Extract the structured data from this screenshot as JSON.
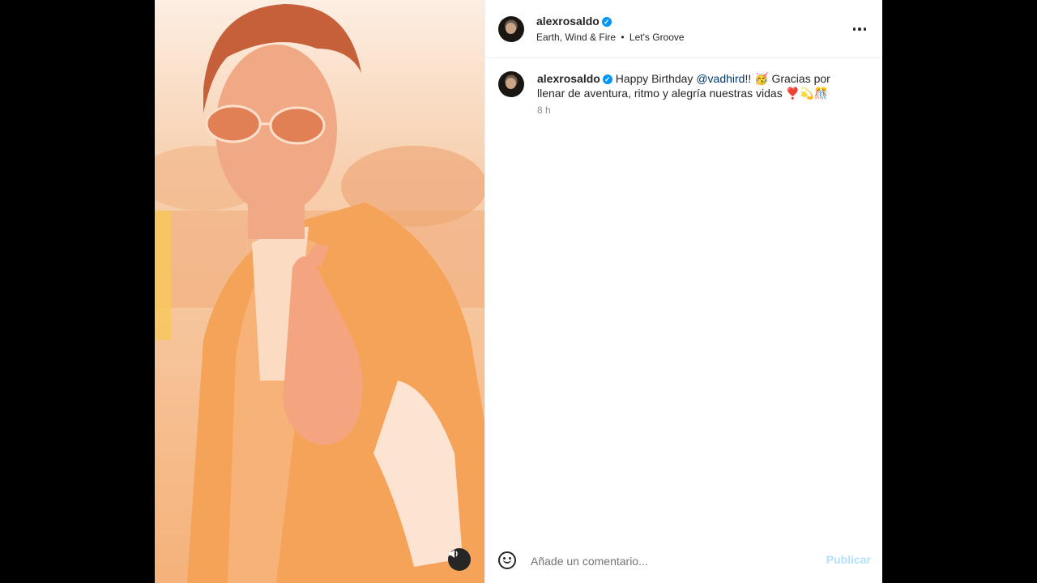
{
  "post": {
    "author": {
      "username": "alexrosaldo",
      "verified": true,
      "music_artist": "Earth, Wind & Fire",
      "music_separator": "•",
      "music_track": "Let's Groove"
    },
    "caption": {
      "username": "alexrosaldo",
      "text_before": " Happy Birthday ",
      "mention": "@vadhird",
      "text_after": "!! 🥳 Gracias por llenar de aventura, ritmo y alegría nuestras vidas ❣️💫🎊"
    },
    "timestamp": "8 h",
    "comment": {
      "placeholder": "Añade un comentario...",
      "value": "",
      "publish_label": "Publicar"
    }
  },
  "colors": {
    "verified_badge": "#0095f6",
    "mention": "#00376b",
    "publish_disabled": "#b2dffc",
    "video_tint": "#f6b980"
  },
  "icons": {
    "more": "more-horizontal-icon",
    "mute": "speaker-icon",
    "emoji": "emoji-smile-icon",
    "verified": "verified-badge-icon"
  }
}
